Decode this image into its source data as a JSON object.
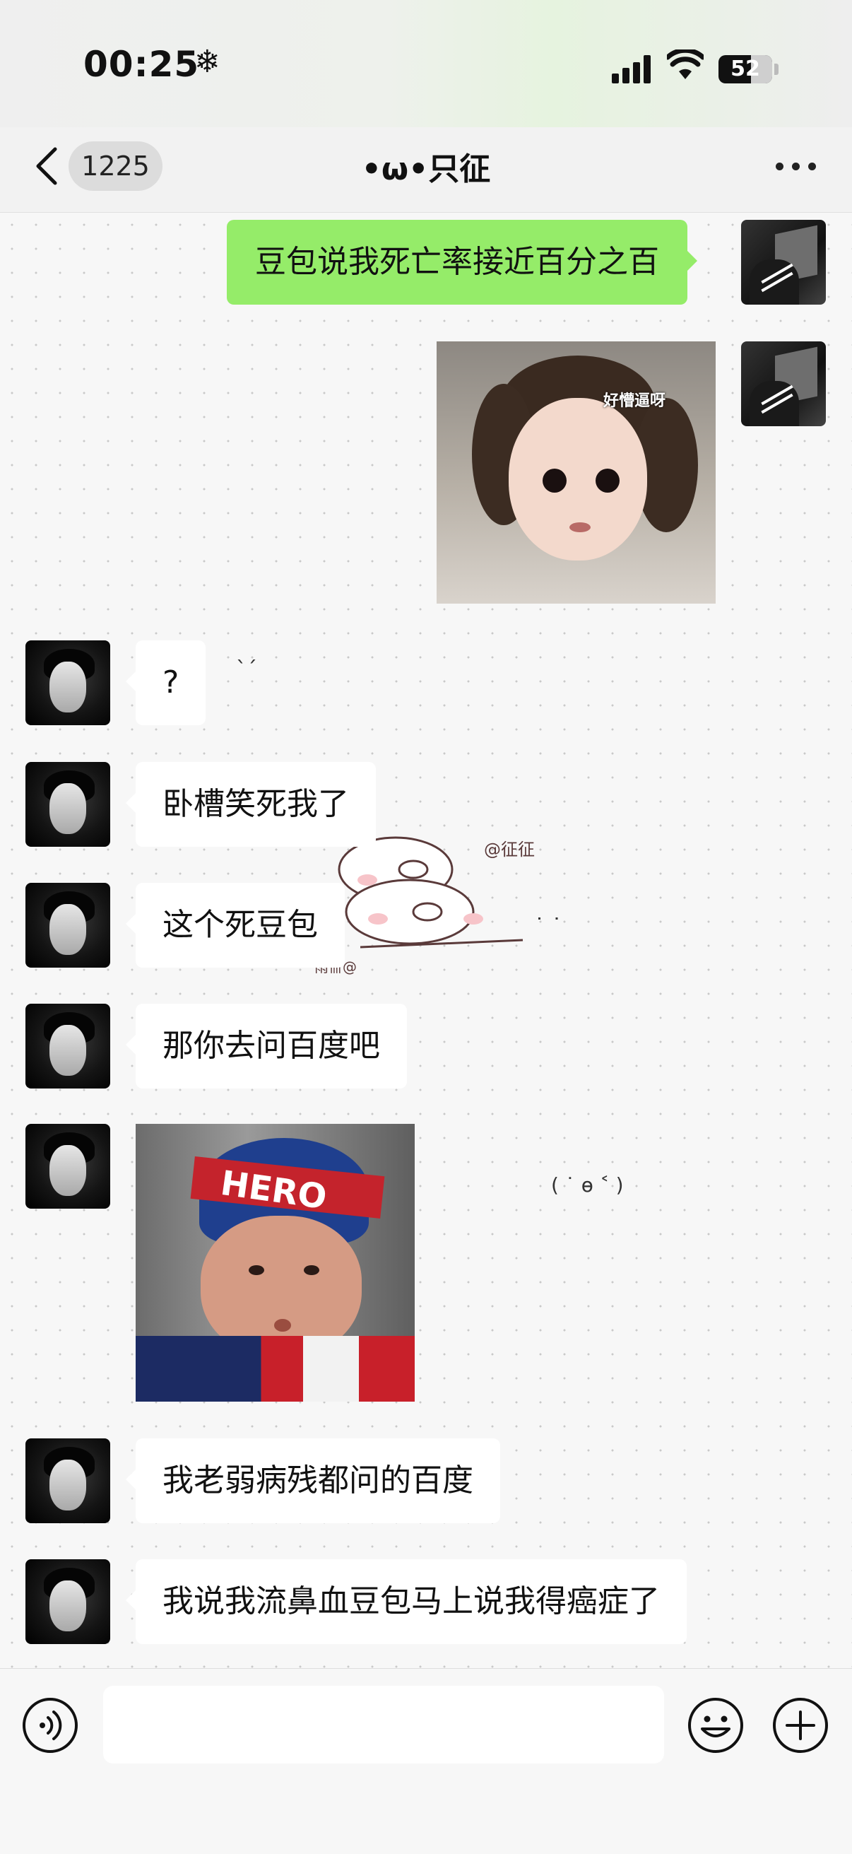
{
  "status_bar": {
    "time": "00:25",
    "focus_glyph": "❄",
    "battery": "52"
  },
  "header": {
    "unread_count": "1225",
    "title": "•ω•只征"
  },
  "messages": [
    {
      "from": "me",
      "type": "text",
      "text": "豆包说我死亡率接近百分之百"
    },
    {
      "from": "me",
      "type": "image",
      "caption": "好懵逼呀"
    },
    {
      "from": "friend",
      "type": "text",
      "text": "?"
    },
    {
      "from": "friend",
      "type": "text",
      "text": "卧槽笑死我了"
    },
    {
      "from": "friend",
      "type": "text",
      "text": "这个死豆包"
    },
    {
      "from": "friend",
      "type": "text",
      "text": "那你去问百度吧"
    },
    {
      "from": "friend",
      "type": "image",
      "caption": "HERO"
    },
    {
      "from": "friend",
      "type": "text",
      "text": "我老弱病残都问的百度"
    },
    {
      "from": "friend",
      "type": "text",
      "text": "我说我流鼻血豆包马上说我得癌症了"
    }
  ],
  "background_stickers": {
    "pig_tag_top": "@征征",
    "pig_tag_bottom": "雨卌@",
    "kaomoji": "( ˙ ɵ ˂ )",
    "dots_1": "ˋˊ",
    "dots_2": "˙ ˙"
  },
  "input": {
    "value": ""
  },
  "colors": {
    "my_bubble": "#95ec69",
    "friend_bubble": "#ffffff",
    "background": "#f7f7f7"
  },
  "icons": [
    "back-chevron-icon",
    "more-dots-icon",
    "voice-icon",
    "emoji-icon",
    "plus-icon"
  ]
}
